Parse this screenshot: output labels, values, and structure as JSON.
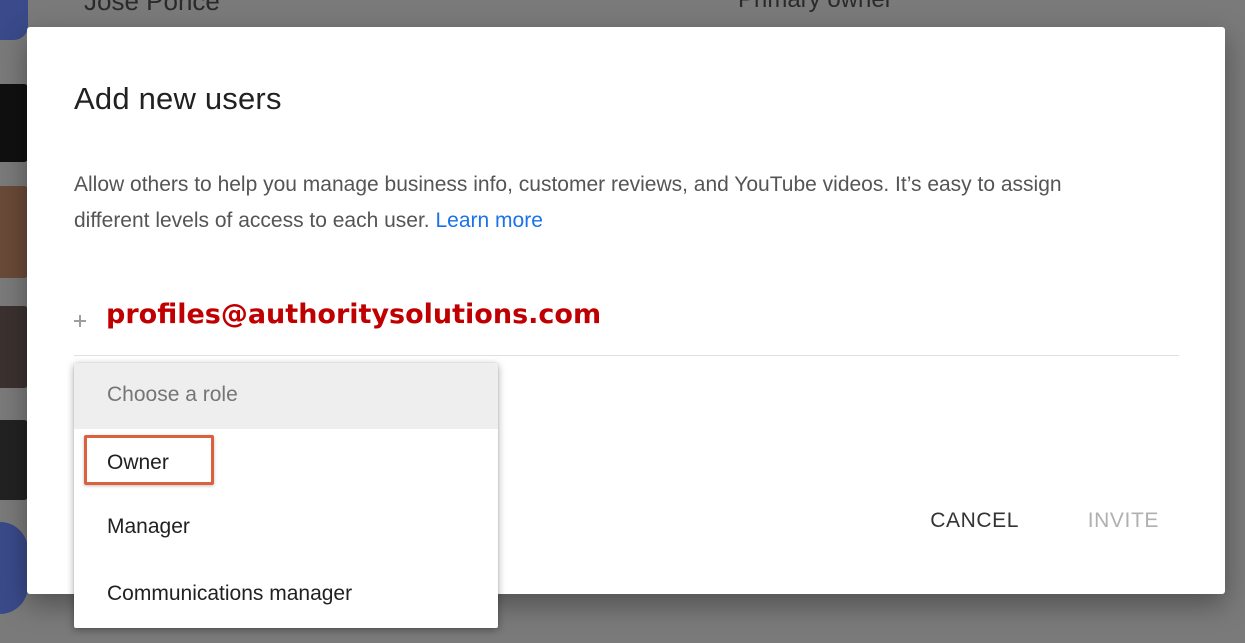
{
  "background": {
    "owner_name": "Jose Ponce",
    "owner_role": "Primary owner"
  },
  "dialog": {
    "title": "Add new users",
    "description": "Allow others to help you manage business info, customer reviews, and YouTube videos. It’s easy to assign different levels of access to each user.",
    "learn_more": "Learn more",
    "email_value": "profiles@authoritysolutions.com",
    "cancel_label": "CANCEL",
    "invite_label": "INVITE"
  },
  "role_menu": {
    "placeholder": "Choose a role",
    "items": [
      {
        "label": "Owner"
      },
      {
        "label": "Manager"
      },
      {
        "label": "Communications manager"
      }
    ],
    "highlighted": "Owner"
  },
  "colors": {
    "accent_link": "#1a73e8",
    "email_text": "#c00000",
    "highlight_border": "#d9613b",
    "scrim": "#7a7a7a"
  },
  "icons": {
    "add_email": "plus-icon"
  }
}
